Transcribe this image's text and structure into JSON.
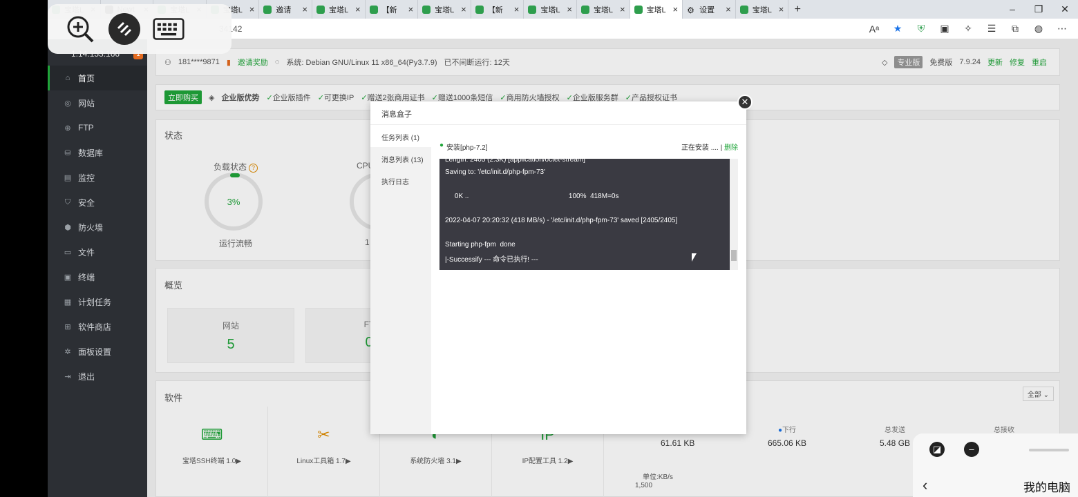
{
  "browser": {
    "tabs": [
      {
        "label": "宝塔L",
        "icon": "shield"
      },
      {
        "label": "Newt",
        "icon": "black"
      },
      {
        "label": "宝塔L",
        "icon": "shield"
      },
      {
        "label": "宝塔L",
        "icon": "shield"
      },
      {
        "label": "邀请",
        "icon": "shield"
      },
      {
        "label": "宝塔L",
        "icon": "shield"
      },
      {
        "label": "【新",
        "icon": "shield"
      },
      {
        "label": "宝塔L",
        "icon": "shield"
      },
      {
        "label": "【新",
        "icon": "shield"
      },
      {
        "label": "宝塔L",
        "icon": "shield"
      },
      {
        "label": "宝塔L",
        "icon": "shield"
      },
      {
        "label": "宝塔L",
        "icon": "shield",
        "active": true
      },
      {
        "label": "设置",
        "icon": "gear"
      },
      {
        "label": "宝塔L",
        "icon": "shield"
      }
    ],
    "url_fragment": "34142"
  },
  "sidebar": {
    "ip": "1.14.153.166",
    "badge": "1",
    "items": [
      {
        "label": "首页",
        "icon": "home-icon",
        "active": true
      },
      {
        "label": "网站",
        "icon": "globe-icon"
      },
      {
        "label": "FTP",
        "icon": "ftp-icon"
      },
      {
        "label": "数据库",
        "icon": "database-icon"
      },
      {
        "label": "监控",
        "icon": "monitor-icon"
      },
      {
        "label": "安全",
        "icon": "shield-icon"
      },
      {
        "label": "防火墙",
        "icon": "firewall-icon"
      },
      {
        "label": "文件",
        "icon": "folder-icon"
      },
      {
        "label": "终端",
        "icon": "terminal-icon"
      },
      {
        "label": "计划任务",
        "icon": "calendar-icon"
      },
      {
        "label": "软件商店",
        "icon": "apps-icon"
      },
      {
        "label": "面板设置",
        "icon": "settings-icon"
      },
      {
        "label": "退出",
        "icon": "logout-icon"
      }
    ]
  },
  "infobar": {
    "user": "181****9871",
    "invite": "邀请奖励",
    "system": "系统:  Debian GNU/Linux 11 x86_64(Py3.7.9)",
    "uptime": "已不间断运行: 12天",
    "pro_label": "专业版",
    "free_label": "免费版",
    "version": "7.9.24",
    "update": "更新",
    "repair": "修复",
    "restart": "重启"
  },
  "promo": {
    "buy": "立即购买",
    "title": "企业版优势",
    "items": [
      "企业版插件",
      "可更换IP",
      "赠送2张商用证书",
      "赠送1000条短信",
      "商用防火墙授权",
      "企业版服务群",
      "产品授权证书"
    ]
  },
  "status": {
    "title": "状态",
    "load_label": "负载状态",
    "load_value": "3%",
    "load_text": "运行流畅",
    "cpu_label": "CPU",
    "cpu_fragment": "1"
  },
  "overview": {
    "title": "概览",
    "website_label": "网站",
    "website_count": "5",
    "ftp_label": "FT",
    "ftp_count": "0"
  },
  "software": {
    "title": "软件",
    "filter": "全部",
    "items": [
      {
        "name": "宝塔SSH终端 1.0▶",
        "icon": "terminal-icon"
      },
      {
        "name": "Linux工具箱 1.7▶",
        "icon": "tools-icon"
      },
      {
        "name": "系统防火墙 3.1▶",
        "icon": "firewall-icon"
      },
      {
        "name": "IP配置工具 1.2▶",
        "icon": "ip-icon"
      }
    ],
    "net": {
      "up_label": "上行",
      "up_value": "61.61 KB",
      "down_label": "下行",
      "down_value": "665.06 KB",
      "sent_label": "总发送",
      "sent_value": "5.48 GB",
      "recv_label": "总接收",
      "unit": "单位:KB/s",
      "tick": "1,500"
    }
  },
  "modal": {
    "title": "消息盒子",
    "tabs": [
      "任务列表 (1)",
      "消息列表 (13)",
      "执行日志"
    ],
    "task_name": "安装[php-7.2]",
    "task_status": "正在安装 ....",
    "task_delete": "删除",
    "console_lines": [
      "Length: 2405 (2.3K) [application/octet-stream]",
      "Saving to: '/etc/init.d/php-fpm-73'",
      "",
      "     0K ..                                                    100%  418M=0s",
      "",
      "2022-04-07 20:20:32 (418 MB/s) - '/etc/init.d/php-fpm-73' saved [2405/2405]",
      "",
      "Starting php-fpm  done",
      "|-Successify --- 命令已执行! ---"
    ]
  },
  "mini_panel": {
    "title": "我的电脑"
  },
  "colors": {
    "accent": "#20a53a",
    "sidebar_bg": "#2c2f34",
    "console_bg": "#3a3a42"
  }
}
